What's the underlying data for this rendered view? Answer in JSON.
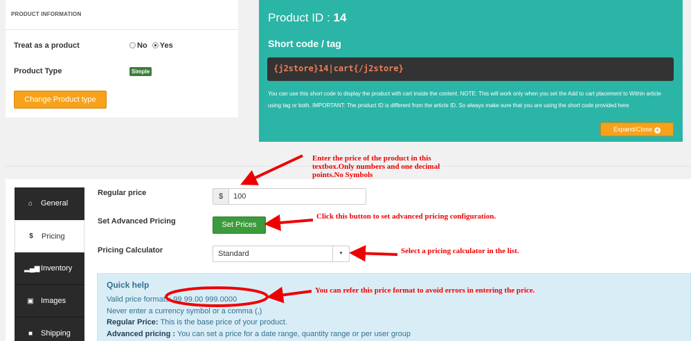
{
  "product_info": {
    "heading": "PRODUCT INFORMATION",
    "treat_label": "Treat as a product",
    "opt_no": "No",
    "opt_yes": "Yes",
    "type_label": "Product Type",
    "type_badge": "Simple",
    "change_btn": "Change Product type"
  },
  "shortcode_panel": {
    "id_label": "Product ID :",
    "id_value": "14",
    "title": "Short code / tag",
    "code": "{j2store}14|cart{/j2store}",
    "note": "You can use this short code to display the product with cart inside the content. NOTE: This will work only when you set the Add to cart placement to Within article using tag or both. IMPORTANT: The product ID is different from the article ID. So always make sure that you are using the short code provided here",
    "expand_btn": "Expand/Close"
  },
  "tabs": [
    {
      "label": "General",
      "icon": "home-icon",
      "active": false
    },
    {
      "label": "Pricing",
      "icon": "dollar-icon",
      "active": true
    },
    {
      "label": "Inventory",
      "icon": "signal-icon",
      "active": false
    },
    {
      "label": "Images",
      "icon": "image-icon",
      "active": false
    },
    {
      "label": "Shipping",
      "icon": "truck-icon",
      "active": false
    }
  ],
  "pricing": {
    "regular_label": "Regular price",
    "currency": "$",
    "regular_value": "100",
    "advanced_label": "Set Advanced Pricing",
    "set_prices_btn": "Set Prices",
    "calc_label": "Pricing Calculator",
    "calc_value": "Standard"
  },
  "help": {
    "title": "Quick help",
    "line1": "Valid price formats: 99 99.00 999.0000",
    "line2": "Never enter a currency symbol or a comma (,)",
    "line3_bold": "Regular Price:",
    "line3": " This is the base price of your product.",
    "line4_bold": "Advanced pricing :",
    "line4": " You can set a price for a date range, quantity range or per user group"
  },
  "annotations": {
    "price": "Enter the price of the product in this textbox.Only numbers and one decimal points.No Symbols",
    "set_prices": "Click this button to set advanced pricing configuration.",
    "calculator": "Select a pricing calculator in the list.",
    "format": "You can refer this price format to avoid errors in entering the price."
  },
  "colors": {
    "teal": "#2bb5a6",
    "orange": "#f7a21a",
    "green": "#3c9b3c",
    "annotation_red": "#ee0000"
  }
}
